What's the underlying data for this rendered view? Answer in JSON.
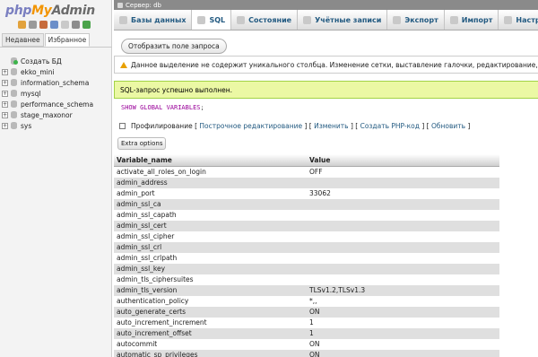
{
  "sidebar": {
    "logo": {
      "php": "php",
      "my": "My",
      "admin": "Admin"
    },
    "tabs": [
      "Недавнее",
      "Избранное"
    ],
    "tree": [
      {
        "label": "Создать БД",
        "type": "new"
      },
      {
        "label": "ekko_mini",
        "type": "db"
      },
      {
        "label": "information_schema",
        "type": "db"
      },
      {
        "label": "mysql",
        "type": "db"
      },
      {
        "label": "performance_schema",
        "type": "db"
      },
      {
        "label": "stage_maxonor",
        "type": "db"
      },
      {
        "label": "sys",
        "type": "db"
      }
    ]
  },
  "topbar": {
    "label": "Сервер: db"
  },
  "tabs": [
    {
      "label": "Базы данных",
      "icon": "databases-icon"
    },
    {
      "label": "SQL",
      "icon": "sql-icon"
    },
    {
      "label": "Состояние",
      "icon": "status-icon"
    },
    {
      "label": "Учётные записи",
      "icon": "users-icon"
    },
    {
      "label": "Экспорт",
      "icon": "export-icon"
    },
    {
      "label": "Импорт",
      "icon": "import-icon"
    },
    {
      "label": "Настройки",
      "icon": "settings-icon"
    }
  ],
  "main": {
    "show_query_button": "Отобразить поле запроса",
    "notice": "Данное выделение не содержит уникального столбца. Изменение сетки, выставление галочки, редактирование, копирование и удаление недоступны.",
    "success": "SQL-запрос успешно выполнен.",
    "sql_keyword": "SHOW GLOBAL VARIABLES",
    "sql_end": ";",
    "profiling": {
      "label": "Профилирование",
      "lb1": "[",
      "inline_edit": "Построчное редактирование",
      "sep1": "] [",
      "edit": "Изменить",
      "sep2": "] [",
      "php_code": "Создать PHP-код",
      "sep3": "] [",
      "refresh": "Обновить",
      "rb": "]"
    },
    "extra_options": "Extra options"
  },
  "table": {
    "headers": [
      "Variable_name",
      "Value"
    ],
    "rows": [
      [
        "activate_all_roles_on_login",
        "OFF"
      ],
      [
        "admin_address",
        ""
      ],
      [
        "admin_port",
        "33062"
      ],
      [
        "admin_ssl_ca",
        ""
      ],
      [
        "admin_ssl_capath",
        ""
      ],
      [
        "admin_ssl_cert",
        ""
      ],
      [
        "admin_ssl_cipher",
        ""
      ],
      [
        "admin_ssl_crl",
        ""
      ],
      [
        "admin_ssl_crlpath",
        ""
      ],
      [
        "admin_ssl_key",
        ""
      ],
      [
        "admin_tls_ciphersuites",
        ""
      ],
      [
        "admin_tls_version",
        "TLSv1.2,TLSv1.3"
      ],
      [
        "authentication_policy",
        "*,,"
      ],
      [
        "auto_generate_certs",
        "ON"
      ],
      [
        "auto_increment_increment",
        "1"
      ],
      [
        "auto_increment_offset",
        "1"
      ],
      [
        "autocommit",
        "ON"
      ],
      [
        "automatic_sp_privileges",
        "ON"
      ]
    ]
  }
}
